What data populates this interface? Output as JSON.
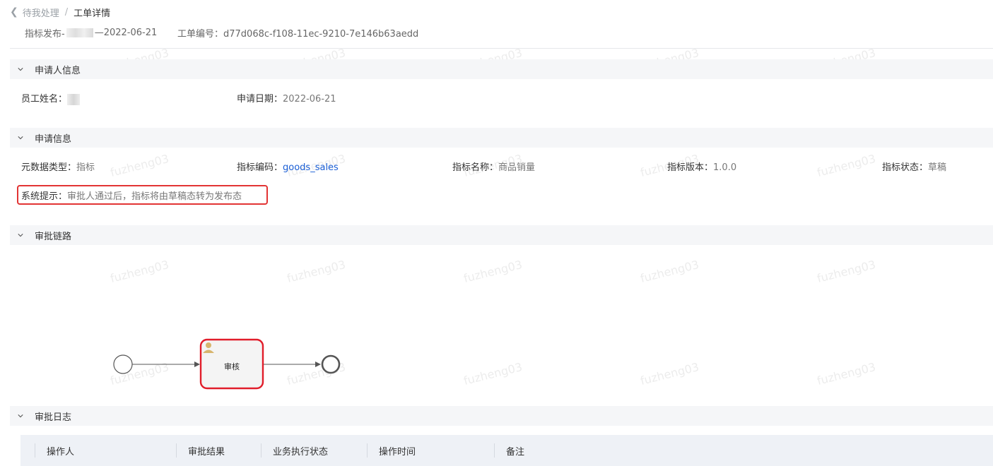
{
  "breadcrumb": {
    "back_icon": "chevron-left-icon",
    "previous": "待我处理",
    "separator": "/",
    "current": "工单详情"
  },
  "header": {
    "title_prefix": "指标发布-",
    "title_suffix": "—2022-06-21",
    "order_no_label": "工单编号：",
    "order_no": "d77d068c-f108-11ec-9210-7e146b63aedd"
  },
  "sections": {
    "applicant": {
      "title": "申请人信息",
      "employee_label": "员工姓名：",
      "date_label": "申请日期：",
      "date_value": "2022-06-21"
    },
    "application": {
      "title": "申请信息",
      "fields": [
        {
          "label": "元数据类型：",
          "value": "指标"
        },
        {
          "label": "指标编码：",
          "value": "goods_sales"
        },
        {
          "label": "指标名称：",
          "value": "商品销量"
        },
        {
          "label": "指标版本：",
          "value": "1.0.0"
        },
        {
          "label": "指标状态：",
          "value": "草稿"
        }
      ],
      "hint_label": "系统提示：",
      "hint_text": "审批人通过后，指标将由草稿态转为发布态"
    },
    "approval_chain": {
      "title": "审批链路",
      "task_label": "审核",
      "task_icon": "user-icon"
    },
    "approval_log": {
      "title": "审批日志",
      "columns": [
        "操作人",
        "审批结果",
        "业务执行状态",
        "操作时间",
        "备注"
      ]
    }
  },
  "watermark": "fuzheng03",
  "colors": {
    "link": "#1b5fd6",
    "highlight_border": "#e23434",
    "section_bg": "#f5f6f8",
    "table_header_bg": "#eef1f6"
  }
}
